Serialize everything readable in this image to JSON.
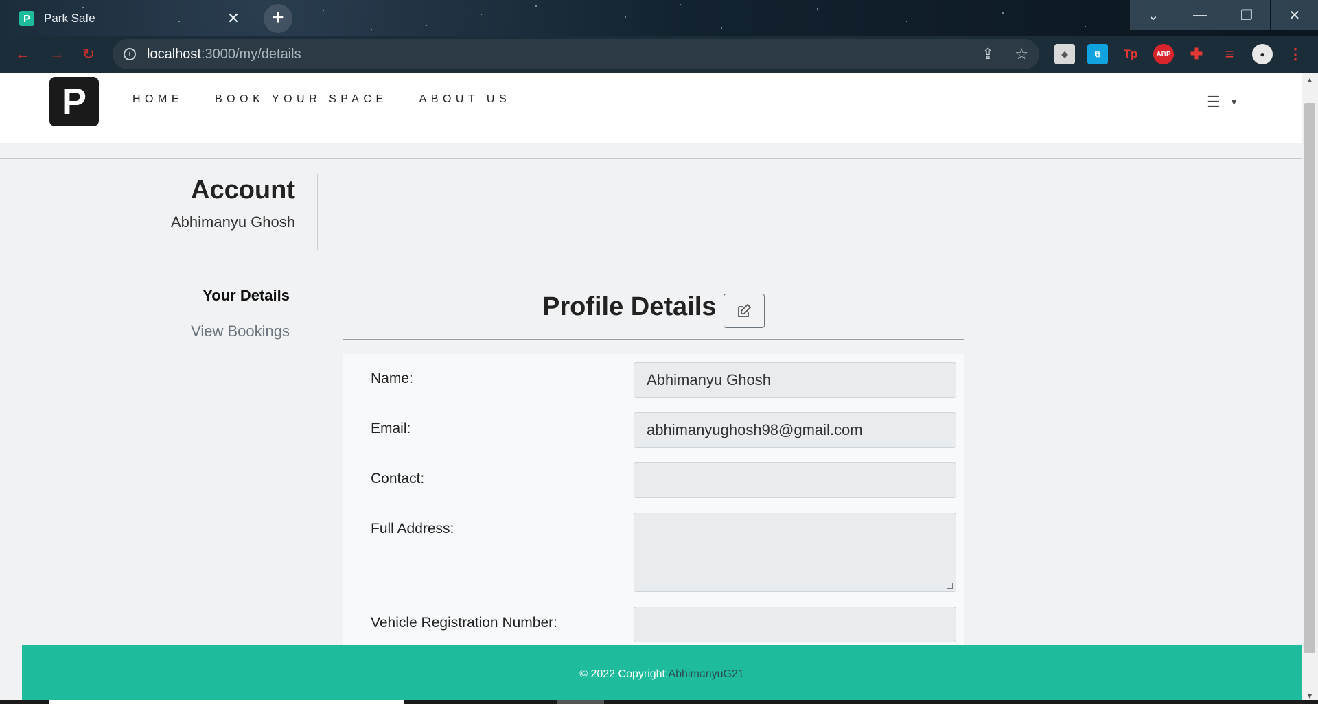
{
  "browser": {
    "tab_title": "Park Safe",
    "favicon_letter": "P",
    "url_host": "localhost",
    "url_path": ":3000/my/details",
    "ext_abp": "ABP",
    "ext_tp": "Tp"
  },
  "site": {
    "logo_letter": "P",
    "nav": [
      "HOME",
      "BOOK YOUR SPACE",
      "ABOUT US"
    ]
  },
  "account": {
    "title": "Account",
    "user_name": "Abhimanyu Ghosh"
  },
  "side_menu": {
    "your_details": "Your Details",
    "view_bookings": "View Bookings"
  },
  "profile": {
    "title": "Profile Details",
    "fields": [
      {
        "label": "Name:",
        "value": "Abhimanyu Ghosh"
      },
      {
        "label": "Email:",
        "value": "abhimanyughosh98@gmail.com"
      },
      {
        "label": "Contact:",
        "value": ""
      },
      {
        "label": "Full Address:",
        "value": ""
      },
      {
        "label": "Vehicle Registration Number:",
        "value": ""
      }
    ]
  },
  "footer": {
    "copyright": "© 2022 Copyright:",
    "author": "AbhimanyuG21"
  },
  "colors": {
    "accent": "#1ebc9c",
    "field_bg": "#e9ecef",
    "reload_red": "#c9302c"
  }
}
